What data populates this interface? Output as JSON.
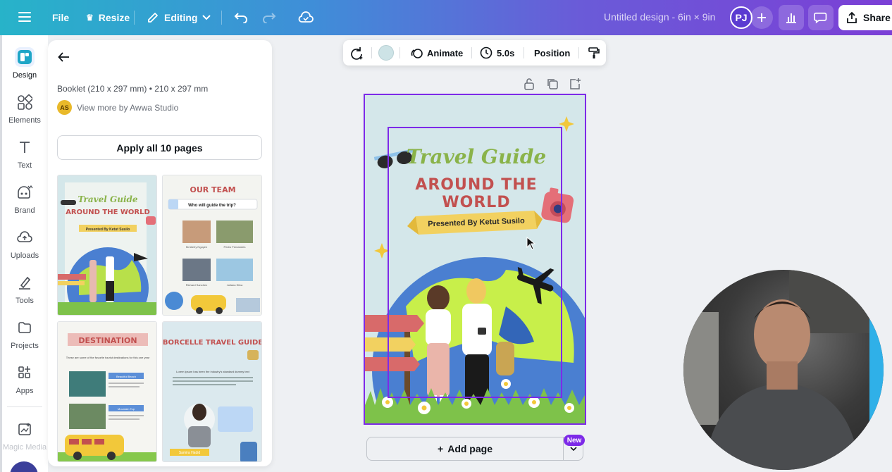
{
  "topbar": {
    "file_label": "File",
    "resize_label": "Resize",
    "editing_label": "Editing",
    "doc_title": "Untitled design - 6in × 9in",
    "user_initials": "PJ",
    "share_label": "Share"
  },
  "rail": {
    "items": [
      {
        "label": "Design",
        "icon": "design-icon"
      },
      {
        "label": "Elements",
        "icon": "elements-icon"
      },
      {
        "label": "Text",
        "icon": "text-icon"
      },
      {
        "label": "Brand",
        "icon": "brand-icon"
      },
      {
        "label": "Uploads",
        "icon": "uploads-icon"
      },
      {
        "label": "Tools",
        "icon": "tools-icon"
      },
      {
        "label": "Projects",
        "icon": "projects-icon"
      },
      {
        "label": "Apps",
        "icon": "apps-icon"
      },
      {
        "label": "Magic Media",
        "icon": "magic-media-icon"
      }
    ]
  },
  "panel": {
    "dimensions": "Booklet (210 x 297 mm) • 210 x 297 mm",
    "author_initials": "AS",
    "author_link": "View more by Awwa Studio",
    "apply_label": "Apply all 10 pages",
    "thumbs": [
      {
        "title": "Travel Guide",
        "headline": "AROUND THE WORLD",
        "sub": "Presented By Ketut Susilo"
      },
      {
        "title": "OUR TEAM",
        "search": "Who will guide the trip?",
        "names": [
          "Kimberly Nguyen",
          "Pedro Fernandes",
          "Richard Sanchez",
          "Juliana Silva"
        ]
      },
      {
        "title": "DESTINATION",
        "intro": "These are some of the favorite tourist destinations for this one year",
        "tags": [
          "Beautiful Beach",
          "Mountain Top"
        ]
      },
      {
        "title": "BORCELLE TRAVEL GUIDE",
        "caption": "Lorem ipsum has been the industry's standard dummy text",
        "name": "Samira Hadid"
      }
    ]
  },
  "float_toolbar": {
    "animate_label": "Animate",
    "duration_label": "5.0s",
    "position_label": "Position",
    "swatch_color": "#cde3e6"
  },
  "page": {
    "title": "Travel Guide",
    "headline_line1": "AROUND THE",
    "headline_line2": "WORLD",
    "ribbon": "Presented By Ketut Susilo"
  },
  "footer": {
    "add_page_label": "Add page",
    "new_badge": "New"
  },
  "colors": {
    "accent": "#7d2ae8",
    "page_bg": "#d4e7ea",
    "title_green": "#8ab34a",
    "headline_red": "#c2504f"
  }
}
